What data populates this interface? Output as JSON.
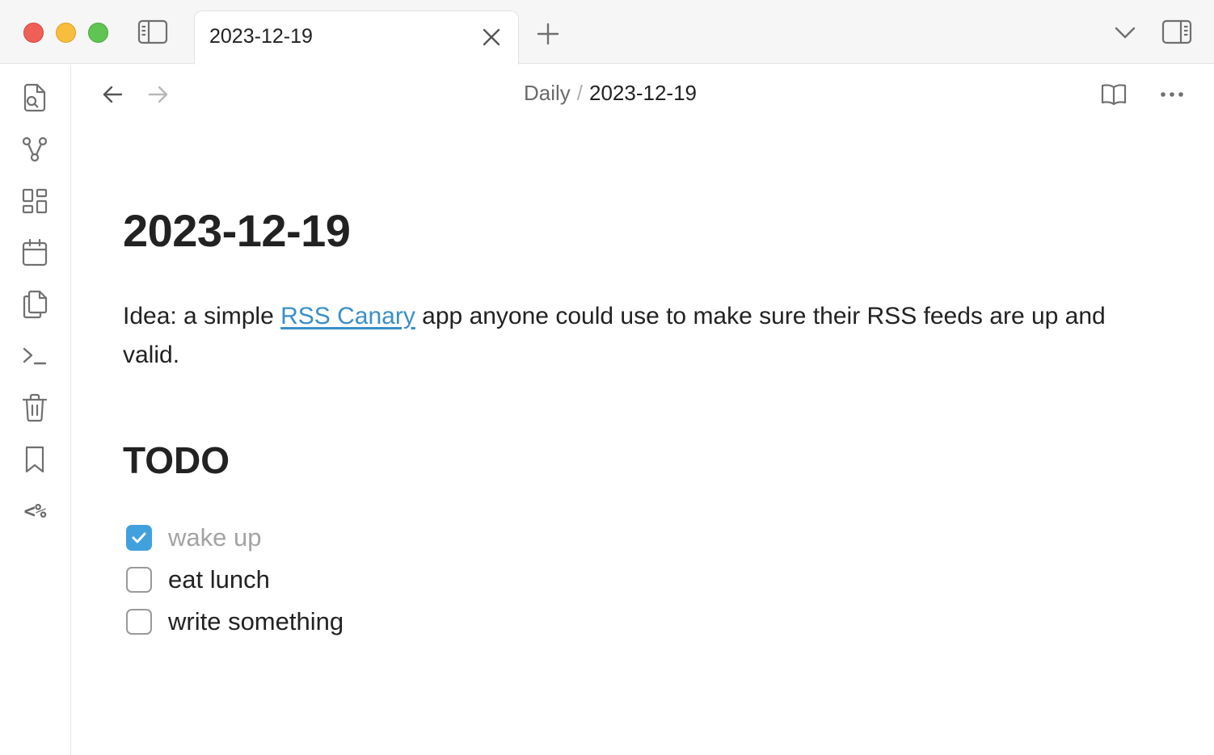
{
  "tab": {
    "title": "2023-12-19"
  },
  "breadcrumb": {
    "parent": "Daily",
    "separator": "/",
    "current": "2023-12-19"
  },
  "note": {
    "title": "2023-12-19",
    "paragraph": {
      "before": "Idea: a simple ",
      "link": "RSS Canary",
      "after": " app anyone could use to make sure their RSS feeds are up and valid."
    },
    "todo_heading": "TODO",
    "todos": [
      {
        "text": "wake up",
        "checked": true
      },
      {
        "text": "eat lunch",
        "checked": false
      },
      {
        "text": "write something",
        "checked": false
      }
    ]
  },
  "ribbon": {
    "items": [
      "search-files-icon",
      "graph-view-icon",
      "dashboard-icon",
      "calendar-icon",
      "copy-icon",
      "terminal-icon",
      "trash-icon",
      "bookmark-icon",
      "templater-icon"
    ],
    "templater_label": "<%"
  },
  "colors": {
    "accent": "#41a1dc",
    "link": "#3a8fc8",
    "traffic_red": "#ee5f58",
    "traffic_yellow": "#f7bd3c",
    "traffic_green": "#5fc453"
  }
}
